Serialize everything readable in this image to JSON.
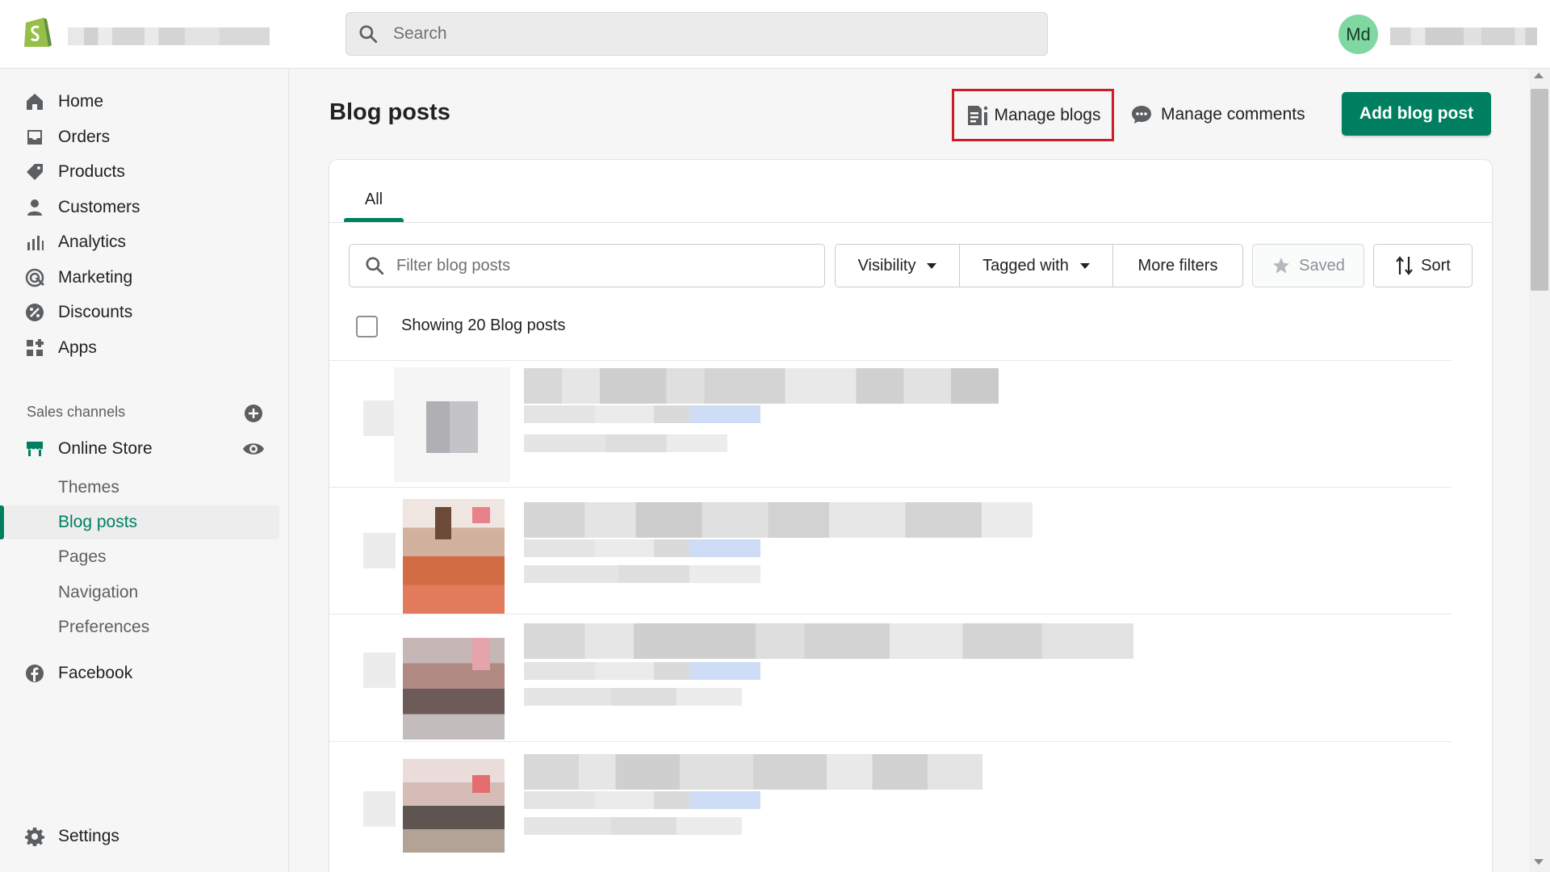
{
  "topbar": {
    "search_placeholder": "Search",
    "avatar_initials": "Md"
  },
  "sidebar": {
    "items": [
      {
        "label": "Home",
        "icon": "home-icon"
      },
      {
        "label": "Orders",
        "icon": "orders-icon"
      },
      {
        "label": "Products",
        "icon": "tag-icon"
      },
      {
        "label": "Customers",
        "icon": "person-icon"
      },
      {
        "label": "Analytics",
        "icon": "bar-chart-icon"
      },
      {
        "label": "Marketing",
        "icon": "target-icon"
      },
      {
        "label": "Discounts",
        "icon": "discount-icon"
      },
      {
        "label": "Apps",
        "icon": "apps-icon"
      }
    ],
    "sales_channels_label": "Sales channels",
    "online_store_label": "Online Store",
    "sub_items": [
      "Themes",
      "Blog posts",
      "Pages",
      "Navigation",
      "Preferences"
    ],
    "active_sub_item": "Blog posts",
    "facebook_label": "Facebook",
    "settings_label": "Settings"
  },
  "main": {
    "title": "Blog posts",
    "manage_blogs_label": "Manage blogs",
    "manage_comments_label": "Manage comments",
    "add_blog_post_label": "Add blog post",
    "tabs": [
      "All"
    ],
    "filter_placeholder": "Filter blog posts",
    "filters": {
      "visibility": "Visibility",
      "tagged_with": "Tagged with",
      "more_filters": "More filters",
      "saved": "Saved",
      "sort": "Sort"
    },
    "showing_text": "Showing 20 Blog posts"
  },
  "colors": {
    "brand_green": "#008060",
    "highlight_red": "#cc1d26",
    "avatar_bg": "#7fd8a1"
  }
}
